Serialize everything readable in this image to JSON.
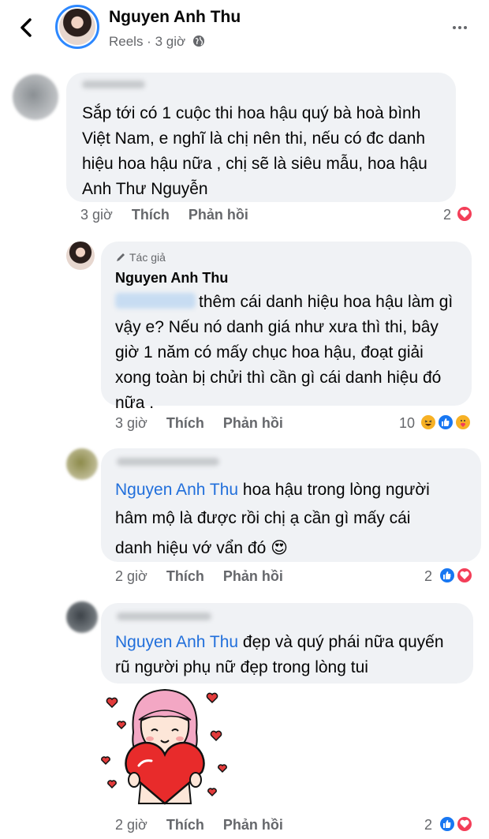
{
  "header": {
    "name": "Nguyen Anh Thu",
    "meta": "Reels · 3 giờ"
  },
  "comments": [
    {
      "text": "Sắp tới có 1 cuộc thi hoa hậu quý bà hoà bình Việt Nam, e nghĩ là chị nên thi, nếu có đc danh hiệu hoa hậu nữa , chị sẽ là siêu mẫu, hoa hậu Anh Thư Nguyễn",
      "lines": [
        "Sắp tới có 1 cuộc thi hoa hậu quý bà hoà bình",
        "Việt Nam, e nghĩ là chị nên thi, nếu có đc danh",
        "hiệu hoa hậu nữa , chị sẽ là siêu mẫu, hoa hậu",
        "Anh Thư Nguyễn"
      ],
      "time": "3 giờ",
      "like_label": "Thích",
      "reply_label": "Phản hồi",
      "reaction_count": "2",
      "reactions": [
        "love-icon"
      ]
    },
    {
      "author_tag": "Tác giả",
      "author": "Nguyen Anh Thu",
      "lines": [
        "thêm cái danh hiệu hoa hậu làm gì",
        "vậy e? Nếu nó danh giá như xưa thì thi, bây",
        "giờ 1 năm có mấy chục hoa hậu, đoạt giải",
        "xong toàn bị chửi thì cần gì cái danh hiệu đó",
        "nữa ."
      ],
      "time": "3 giờ",
      "like_label": "Thích",
      "reply_label": "Phản hồi",
      "reaction_count": "10",
      "reactions": [
        "haha-icon",
        "like-icon",
        "care-icon"
      ]
    },
    {
      "mention": "Nguyen Anh Thu",
      "lines": [
        "hoa hậu trong lòng người",
        "hâm mộ là được rồi chị ạ cần gì mấy cái",
        "danh hiệu vớ vẩn đó 😍"
      ],
      "time": "2 giờ",
      "like_label": "Thích",
      "reply_label": "Phản hồi",
      "reaction_count": "2",
      "reactions": [
        "like-icon",
        "love-icon"
      ]
    },
    {
      "mention": "Nguyen Anh Thu",
      "lines": [
        "đẹp và quý phái nữa quyến",
        "rũ người phụ nữ đẹp trong lòng tui"
      ],
      "time": "2 giờ",
      "like_label": "Thích",
      "reply_label": "Phản hồi",
      "reaction_count": "2",
      "reactions": [
        "like-icon",
        "love-icon"
      ],
      "sticker": "girl-holding-heart-sticker"
    }
  ],
  "colors": {
    "mention": "#216fdb",
    "bubble": "#f0f2f5",
    "meta": "#65676b",
    "love": "#f33e58",
    "like": "#1877f2"
  }
}
